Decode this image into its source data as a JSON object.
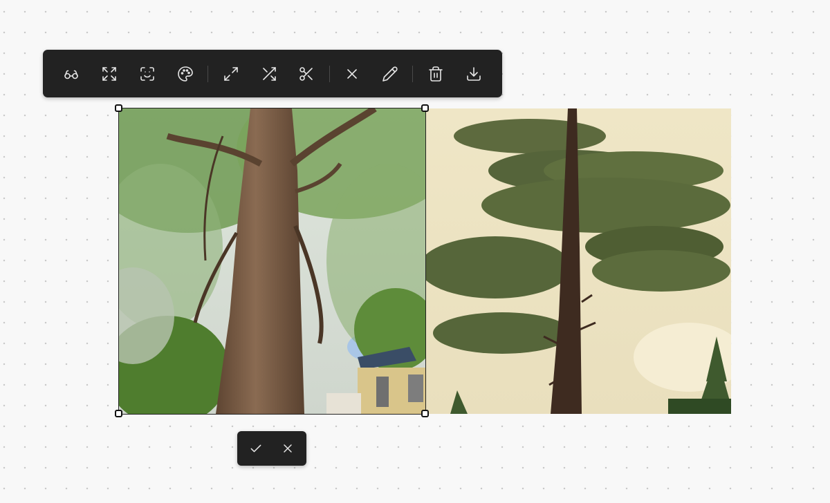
{
  "toolbar": {
    "groups": [
      [
        "glasses-icon",
        "expand-icon",
        "face-scan-icon",
        "palette-icon"
      ],
      [
        "maximize-icon",
        "shuffle-icon",
        "scissors-icon"
      ],
      [
        "close-icon",
        "pencil-icon"
      ],
      [
        "trash-icon",
        "download-icon"
      ]
    ]
  },
  "canvas": {
    "images": [
      {
        "subject": "deciduous-tree",
        "selected": true
      },
      {
        "subject": "pine-tree",
        "selected": false
      }
    ]
  },
  "confirm_bar": {
    "actions": [
      "check-icon",
      "close-icon"
    ]
  },
  "colors": {
    "toolbar_bg": "#222222",
    "canvas_bg": "#f8f8f8",
    "dot": "#c9c9c9",
    "icon": "#e6e6e6"
  }
}
